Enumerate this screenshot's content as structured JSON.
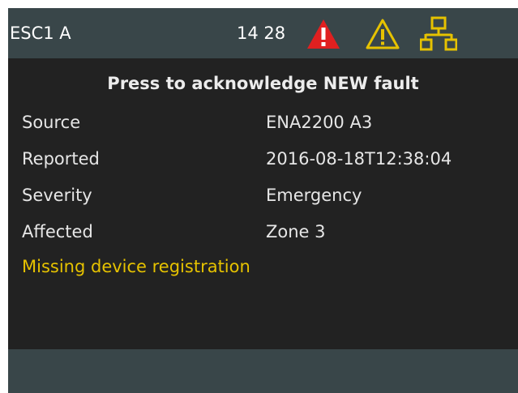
{
  "header": {
    "device_name": "ESC1 A",
    "clock": "14 28",
    "icons": [
      "alarm-icon",
      "warning-icon",
      "network-icon"
    ],
    "colors": {
      "bar": "#394649",
      "alarm": "#e02020",
      "warning": "#e6c200",
      "network": "#e6c200"
    }
  },
  "fault": {
    "title": "Press to acknowledge NEW fault",
    "rows": [
      {
        "label": "Source",
        "value": "ENA2200 A3"
      },
      {
        "label": "Reported",
        "value": "2016-08-18T12:38:04"
      },
      {
        "label": "Severity",
        "value": "Emergency"
      },
      {
        "label": "Affected",
        "value": "Zone 3"
      }
    ],
    "message": "Missing device registration",
    "message_color": "#e6c200"
  }
}
